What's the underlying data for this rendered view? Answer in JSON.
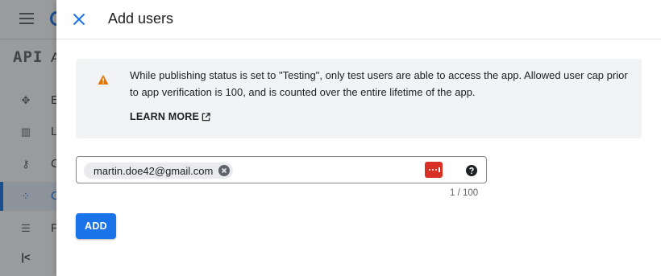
{
  "background": {
    "product_badge": "API",
    "product_initial": "A",
    "nav_items": [
      {
        "icon": "move-icon",
        "letter": "E",
        "active": false
      },
      {
        "icon": "library-icon",
        "letter": "L",
        "active": false
      },
      {
        "icon": "key-icon",
        "letter": "C",
        "active": false
      },
      {
        "icon": "consent-icon",
        "letter": "O",
        "active": true
      },
      {
        "icon": "settings-list-icon",
        "letter": "P",
        "active": false
      }
    ],
    "collapse_icon": "collapse-left-icon"
  },
  "panel": {
    "title": "Add users",
    "close_icon": "close-icon",
    "notice": {
      "icon": "warning-icon",
      "text": "While publishing status is set to \"Testing\", only test users are able to access the app. Allowed user cap prior to app verification is 100, and is counted over the entire lifetime of the app.",
      "link_label": "LEARN MORE",
      "link_icon": "open-in-new-icon"
    },
    "email_input": {
      "chips": [
        "martin.doe42@gmail.com"
      ],
      "counter": "1 / 100"
    },
    "add_button": "ADD"
  },
  "colors": {
    "accent": "#1a73e8",
    "warning": "#e37400",
    "password_manager": "#d93025"
  }
}
